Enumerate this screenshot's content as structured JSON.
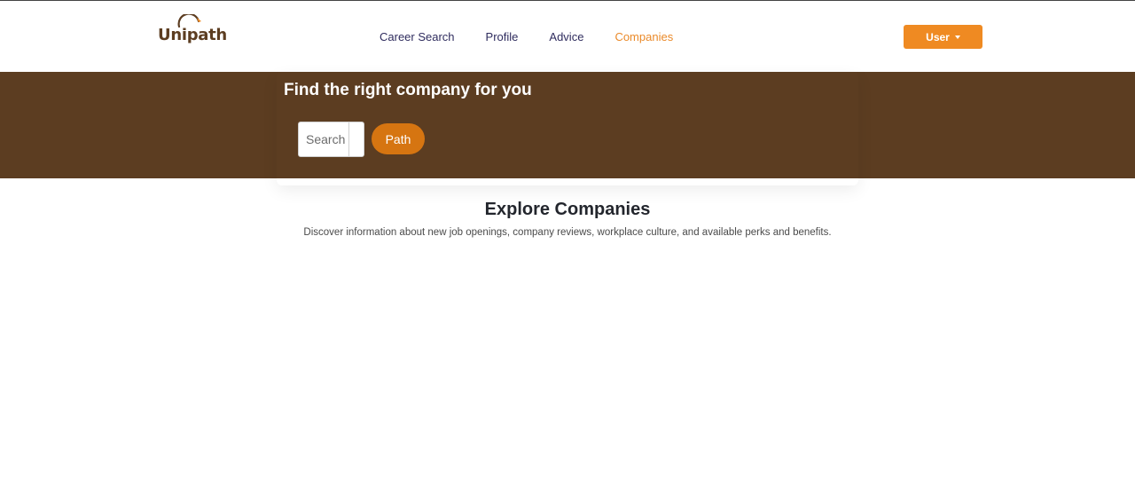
{
  "brand": {
    "name": "Unipath"
  },
  "nav": {
    "links": [
      {
        "label": "Career Search",
        "active": false
      },
      {
        "label": "Profile",
        "active": false
      },
      {
        "label": "Advice",
        "active": false
      },
      {
        "label": "Companies",
        "active": true
      }
    ],
    "user_button": "User"
  },
  "banner": {
    "title": "Find the right company for you",
    "search_placeholder": "Search",
    "path_button": "Path"
  },
  "explore": {
    "title": "Explore Companies",
    "description": "Discover information about new job openings, company reviews, workplace culture, and available perks and benefits."
  },
  "colors": {
    "brand_brown": "#5c3d21",
    "accent_orange": "#ef8a22",
    "path_button": "#d67511",
    "nav_text": "#2f2c5e"
  }
}
